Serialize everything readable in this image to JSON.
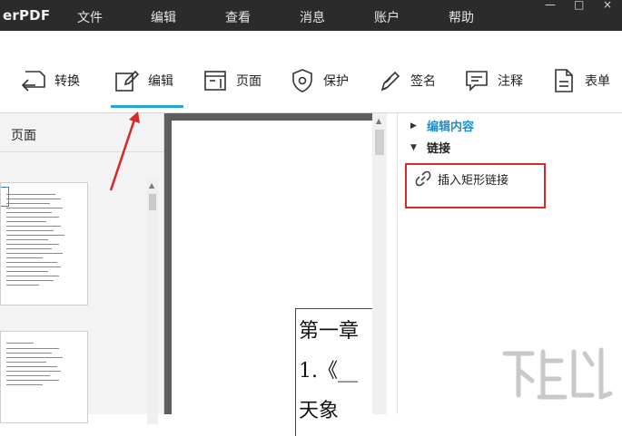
{
  "app": {
    "title": "erPDF"
  },
  "menu": {
    "items": [
      "文件",
      "编辑",
      "查看",
      "消息",
      "账户",
      "帮助"
    ]
  },
  "window_controls": {
    "minimize": "—",
    "maximize": "□",
    "close": "×"
  },
  "toolbar": {
    "items": [
      {
        "label": "转换",
        "icon": "convert-icon"
      },
      {
        "label": "编辑",
        "icon": "edit-pen-icon",
        "active": true
      },
      {
        "label": "页面",
        "icon": "page-icon"
      },
      {
        "label": "保护",
        "icon": "shield-icon"
      },
      {
        "label": "签名",
        "icon": "signature-pen-icon"
      },
      {
        "label": "注释",
        "icon": "comment-icon"
      },
      {
        "label": "表单",
        "icon": "form-icon"
      }
    ],
    "accent_color": "#23a3d6"
  },
  "pages_panel": {
    "title": "页面"
  },
  "document": {
    "lines": [
      "第一章",
      "1.《__",
      "天象"
    ]
  },
  "properties_panel": {
    "sections": [
      {
        "label": "编辑内容",
        "expanded": false
      },
      {
        "label": "链接",
        "expanded": true
      }
    ],
    "link_action": "插入矩形链接",
    "highlight_color": "#d42b2b"
  },
  "annotation": {
    "color": "#d42b2b"
  }
}
